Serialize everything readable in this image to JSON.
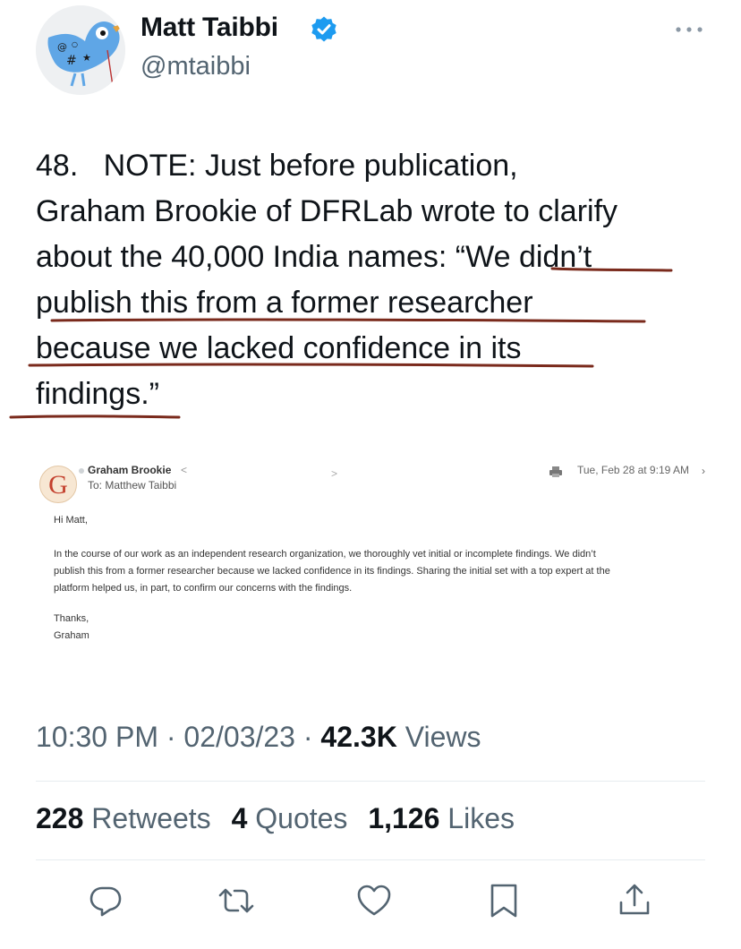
{
  "author": {
    "display_name": "Matt Taibbi",
    "handle": "@mtaibbi",
    "avatar_icon": "bird-avatar-icon",
    "verified_icon": "verified-badge-icon",
    "verified_color": "#1d9bf0"
  },
  "tweet": {
    "lines": [
      "48.   NOTE: Just before publication,",
      "Graham Brookie of DFRLab wrote to clarify",
      "about the 40,000 India names: “We didn’t",
      "publish this from a former researcher",
      "because we lacked confidence in its",
      "findings.”"
    ],
    "underline_color": "#7a2a1c"
  },
  "email": {
    "from": "Graham Brookie",
    "from_chevron": "<",
    "to": "To: Matthew Taibbi",
    "date": "Tue, Feb 28 at 9:19 AM",
    "mid_chevron": ">",
    "date_chevron": "›",
    "logo_letter": "G",
    "greeting": "Hi Matt,",
    "body_lines": [
      "In the course of our work as an independent research organization, we thoroughly vet initial or incomplete findings. We didn’t",
      "publish this from a former researcher because we lacked confidence in its findings. Sharing the initial set with a top expert at the",
      "platform helped us, in part, to confirm our concerns with the findings."
    ],
    "signoff": "Thanks,",
    "signature": "Graham"
  },
  "meta": {
    "time": "10:30 PM",
    "date": "02/03/23",
    "views_count": "42.3K",
    "views_label": "Views",
    "separator": "·"
  },
  "stats": {
    "retweets_count": "228",
    "retweets_label": "Retweets",
    "quotes_count": "4",
    "quotes_label": "Quotes",
    "likes_count": "1,126",
    "likes_label": "Likes"
  },
  "actions": [
    "reply-icon",
    "retweet-icon",
    "like-icon",
    "bookmark-icon",
    "share-icon"
  ],
  "colors": {
    "text_primary": "#0f1419",
    "text_secondary": "#536471",
    "divider": "#e6ecf0"
  }
}
